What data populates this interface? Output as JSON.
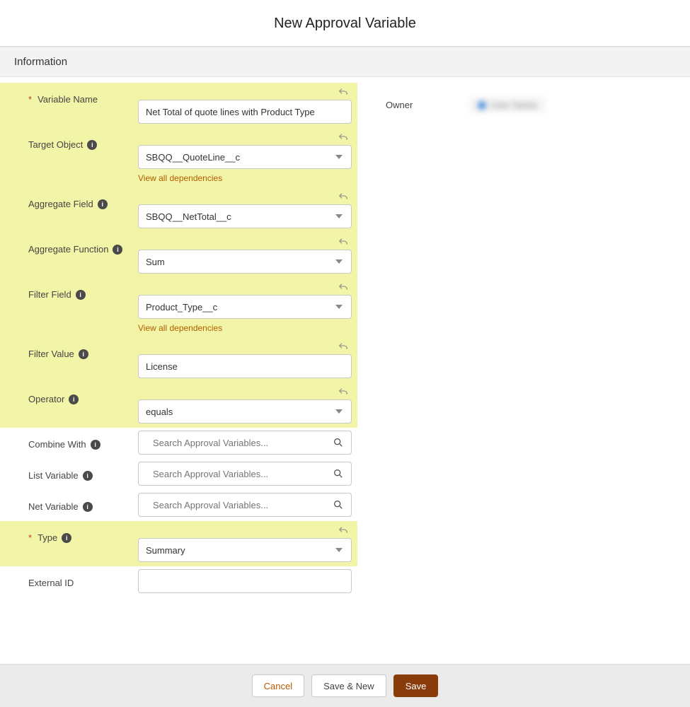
{
  "page_title": "New Approval Variable",
  "section": "Information",
  "owner": {
    "label": "Owner",
    "value": "User Name"
  },
  "deps_link": "View all dependencies",
  "lookup_placeholder": "Search Approval Variables...",
  "fields": {
    "variable_name": {
      "label": "Variable Name",
      "value": "Net Total of quote lines with Product Type"
    },
    "target_object": {
      "label": "Target Object",
      "value": "SBQQ__QuoteLine__c"
    },
    "aggregate_field": {
      "label": "Aggregate Field",
      "value": "SBQQ__NetTotal__c"
    },
    "aggregate_function": {
      "label": "Aggregate Function",
      "value": "Sum"
    },
    "filter_field": {
      "label": "Filter Field",
      "value": "Product_Type__c"
    },
    "filter_value": {
      "label": "Filter Value",
      "value": "License"
    },
    "operator": {
      "label": "Operator",
      "value": "equals"
    },
    "combine_with": {
      "label": "Combine With"
    },
    "list_variable": {
      "label": "List Variable"
    },
    "net_variable": {
      "label": "Net Variable"
    },
    "type": {
      "label": "Type",
      "value": "Summary"
    },
    "external_id": {
      "label": "External ID",
      "value": ""
    }
  },
  "buttons": {
    "cancel": "Cancel",
    "save_new": "Save & New",
    "save": "Save"
  }
}
